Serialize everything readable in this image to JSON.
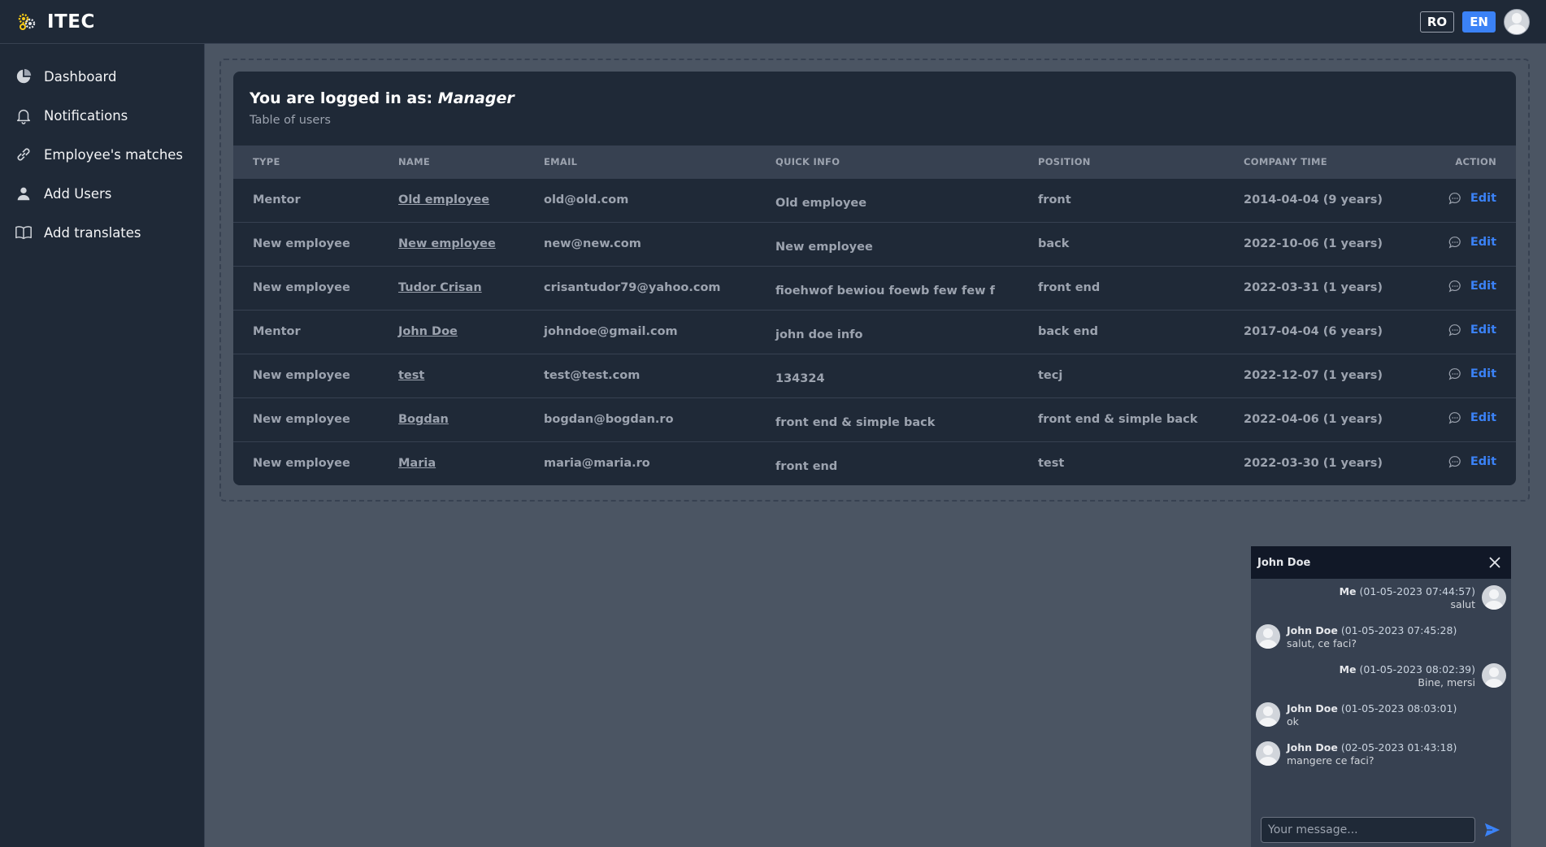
{
  "header": {
    "brand": "ITEC",
    "lang_ro": "RO",
    "lang_en": "EN",
    "logo_icon": "gear-cluster-icon"
  },
  "sidebar": {
    "items": [
      {
        "label": "Dashboard",
        "icon": "pie-chart-icon"
      },
      {
        "label": "Notifications",
        "icon": "bell-icon"
      },
      {
        "label": "Employee's matches",
        "icon": "link-icon"
      },
      {
        "label": "Add Users",
        "icon": "user-icon"
      },
      {
        "label": "Add translates",
        "icon": "book-icon"
      }
    ]
  },
  "card": {
    "title_prefix": "You are logged in as: ",
    "title_role": "Manager",
    "subtitle": "Table of users"
  },
  "table": {
    "headers": [
      "TYPE",
      "NAME",
      "EMAIL",
      "QUICK INFO",
      "POSITION",
      "COMPANY TIME",
      "ACTION"
    ],
    "edit_label": "Edit",
    "rows": [
      {
        "type": "Mentor",
        "name": "Old employee",
        "email": "old@old.com",
        "quick_info": "Old employee",
        "position": "front",
        "company_time": "2014-04-04 (9 years)"
      },
      {
        "type": "New employee",
        "name": "New employee",
        "email": "new@new.com",
        "quick_info": "New employee",
        "position": "back",
        "company_time": "2022-10-06 (1 years)"
      },
      {
        "type": "New employee",
        "name": "Tudor Crisan",
        "email": "crisantudor79@yahoo.com",
        "quick_info": "fioehwof bewiou foewb few few f",
        "position": "front end",
        "company_time": "2022-03-31 (1 years)"
      },
      {
        "type": "Mentor",
        "name": "John Doe",
        "email": "johndoe@gmail.com",
        "quick_info": "john doe info",
        "position": "back end",
        "company_time": "2017-04-04 (6 years)"
      },
      {
        "type": "New employee",
        "name": "test",
        "email": "test@test.com",
        "quick_info": "134324",
        "position": "tecj",
        "company_time": "2022-12-07 (1 years)"
      },
      {
        "type": "New employee",
        "name": "Bogdan",
        "email": "bogdan@bogdan.ro",
        "quick_info": "front end & simple back",
        "position": "front end & simple back",
        "company_time": "2022-04-06 (1 years)"
      },
      {
        "type": "New employee",
        "name": "Maria",
        "email": "maria@maria.ro",
        "quick_info": "front end",
        "position": "test",
        "company_time": "2022-03-30 (1 years)"
      }
    ]
  },
  "chat": {
    "title": "John Doe",
    "input_placeholder": "Your message...",
    "messages": [
      {
        "from": "Me",
        "mine": true,
        "time": "(01-05-2023 07:44:57)",
        "text": "salut"
      },
      {
        "from": "John Doe",
        "mine": false,
        "time": "(01-05-2023 07:45:28)",
        "text": "salut, ce faci?"
      },
      {
        "from": "Me",
        "mine": true,
        "time": "(01-05-2023 08:02:39)",
        "text": "Bine, mersi"
      },
      {
        "from": "John Doe",
        "mine": false,
        "time": "(01-05-2023 08:03:01)",
        "text": "ok"
      },
      {
        "from": "John Doe",
        "mine": false,
        "time": "(02-05-2023 01:43:18)",
        "text": "mangere ce faci?"
      }
    ]
  },
  "colors": {
    "accent": "#3b82f6",
    "panel": "#1f2937",
    "background": "#4b5563"
  }
}
